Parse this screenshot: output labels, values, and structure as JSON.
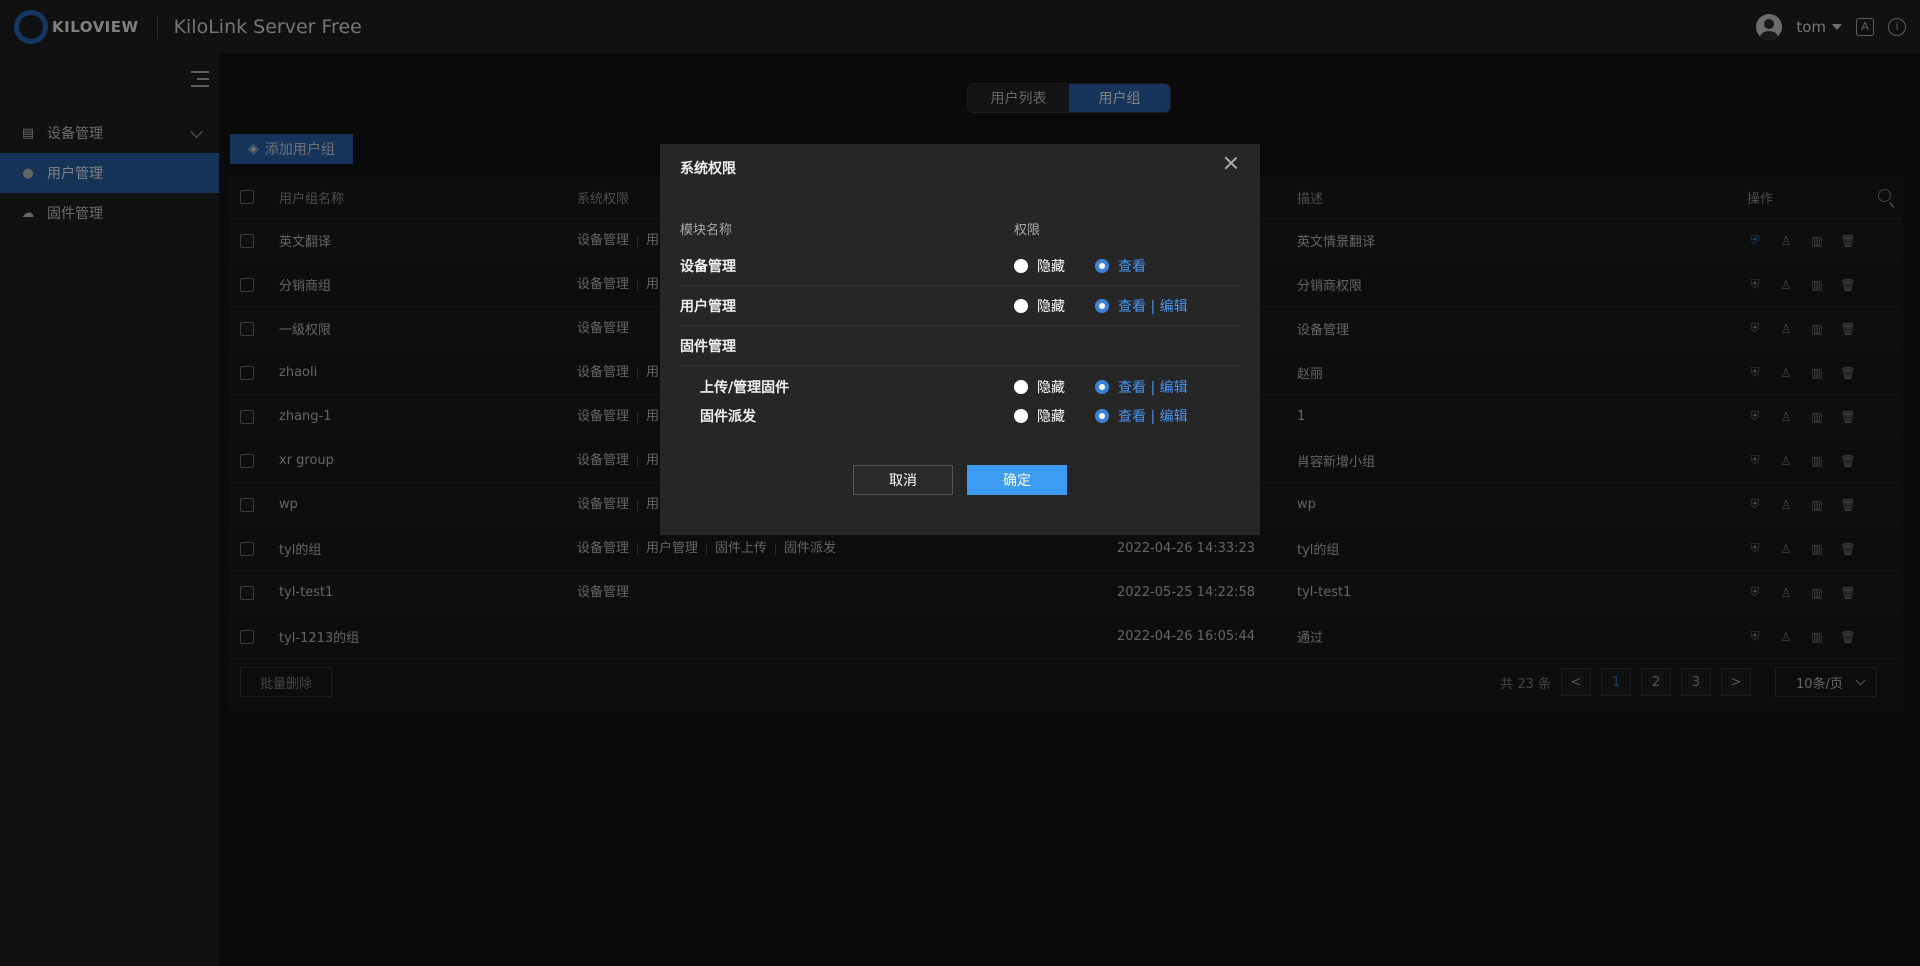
{
  "header": {
    "brand": "KILOVIEW",
    "app_title": "KiloLink Server Free",
    "username": "tom"
  },
  "sidebar": {
    "items": [
      {
        "label": "设备管理",
        "icon": "server-icon"
      },
      {
        "label": "用户管理",
        "icon": "users-icon"
      },
      {
        "label": "固件管理",
        "icon": "cloud-upload-icon"
      }
    ]
  },
  "tabs": [
    {
      "label": "用户列表"
    },
    {
      "label": "用户组"
    }
  ],
  "toolbar": {
    "add_group_label": "添加用户组"
  },
  "table": {
    "headers": {
      "name": "用户组名称",
      "perms": "系统权限",
      "desc": "描述",
      "ops": "操作"
    },
    "rows": [
      {
        "name": "英文翻译",
        "perms": [
          "设备管理",
          "用"
        ],
        "time": "",
        "desc": "英文情景翻译"
      },
      {
        "name": "分销商组",
        "perms": [
          "设备管理",
          "用"
        ],
        "time": "",
        "desc": "分销商权限"
      },
      {
        "name": "一级权限",
        "perms": [
          "设备管理"
        ],
        "time": "",
        "desc": "设备管理"
      },
      {
        "name": "zhaoli",
        "perms": [
          "设备管理",
          "用"
        ],
        "time": "",
        "desc": "赵丽"
      },
      {
        "name": "zhang-1",
        "perms": [
          "设备管理",
          "用"
        ],
        "time": "",
        "desc": "1"
      },
      {
        "name": "xr group",
        "perms": [
          "设备管理",
          "用"
        ],
        "time": "",
        "desc": "肖容新增小组"
      },
      {
        "name": "wp",
        "perms": [
          "设备管理",
          "用"
        ],
        "time": "",
        "desc": "wp"
      },
      {
        "name": "tyl的组",
        "perms": [
          "设备管理",
          "用户管理",
          "固件上传",
          "固件派发"
        ],
        "time": "2022-04-26 14:33:23",
        "desc": "tyl的组"
      },
      {
        "name": "tyl-test1",
        "perms": [
          "设备管理"
        ],
        "time": "2022-05-25 14:22:58",
        "desc": "tyl-test1"
      },
      {
        "name": "tyl-1213的组",
        "perms": [],
        "time": "2022-04-26 16:05:44",
        "desc": "通过"
      }
    ]
  },
  "footer": {
    "bulk_delete_label": "批量删除",
    "total_text": "共 23 条",
    "pages": [
      "1",
      "2",
      "3"
    ],
    "prev": "<",
    "next": ">",
    "page_size": "10条/页"
  },
  "modal": {
    "title": "系统权限",
    "col_module": "模块名称",
    "col_perm": "权限",
    "rows": [
      {
        "name": "设备管理",
        "hide": "隐藏",
        "show": "查看"
      },
      {
        "name": "用户管理",
        "hide": "隐藏",
        "show": "查看 | 编辑"
      },
      {
        "name": "固件管理"
      },
      {
        "name": "上传/管理固件",
        "hide": "隐藏",
        "show": "查看 | 编辑"
      },
      {
        "name": "固件派发",
        "hide": "隐藏",
        "show": "查看 | 编辑"
      }
    ],
    "cancel": "取消",
    "ok": "确定"
  },
  "colors": {
    "accent": "#2c69b3",
    "primary_button": "#3d9bf2",
    "link": "#4a95f0"
  }
}
